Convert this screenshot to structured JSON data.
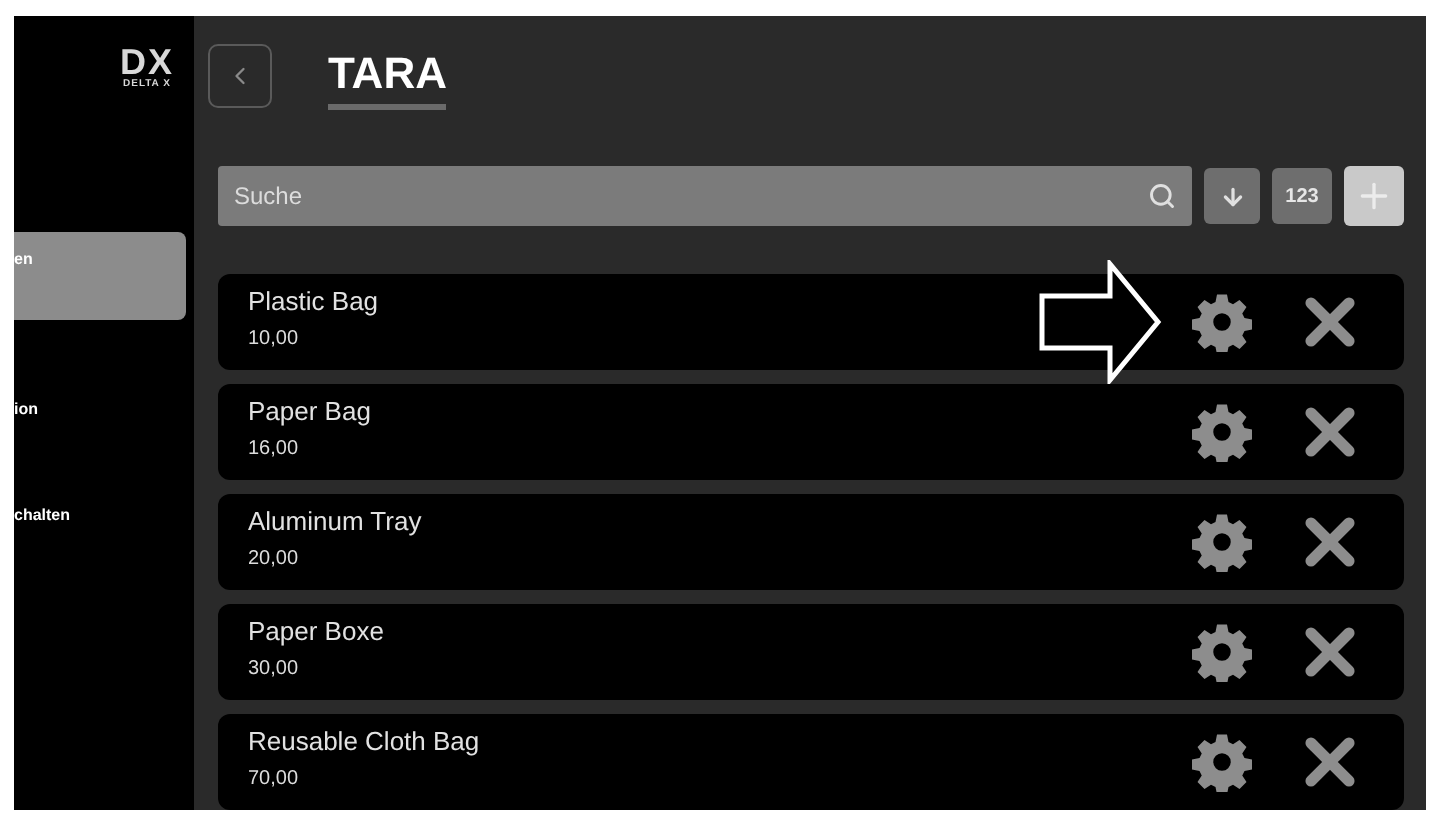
{
  "sidebar": {
    "logo": {
      "mark": "DX",
      "name": "DELTA X"
    },
    "items": [
      {
        "label": "en",
        "selected": true
      },
      {
        "label": "ion",
        "selected": false
      },
      {
        "label": "chalten",
        "selected": false
      }
    ]
  },
  "header": {
    "title": "TARA"
  },
  "toolbar": {
    "search": {
      "placeholder": "Suche"
    },
    "numeric_button": "123"
  },
  "items": [
    {
      "name": "Plastic Bag",
      "value": "10,00",
      "pointer": true
    },
    {
      "name": "Paper Bag",
      "value": "16,00",
      "pointer": false
    },
    {
      "name": "Aluminum Tray",
      "value": "20,00",
      "pointer": false
    },
    {
      "name": "Paper Boxe",
      "value": "30,00",
      "pointer": false
    },
    {
      "name": "Reusable Cloth Bag",
      "value": "70,00",
      "pointer": false
    }
  ]
}
